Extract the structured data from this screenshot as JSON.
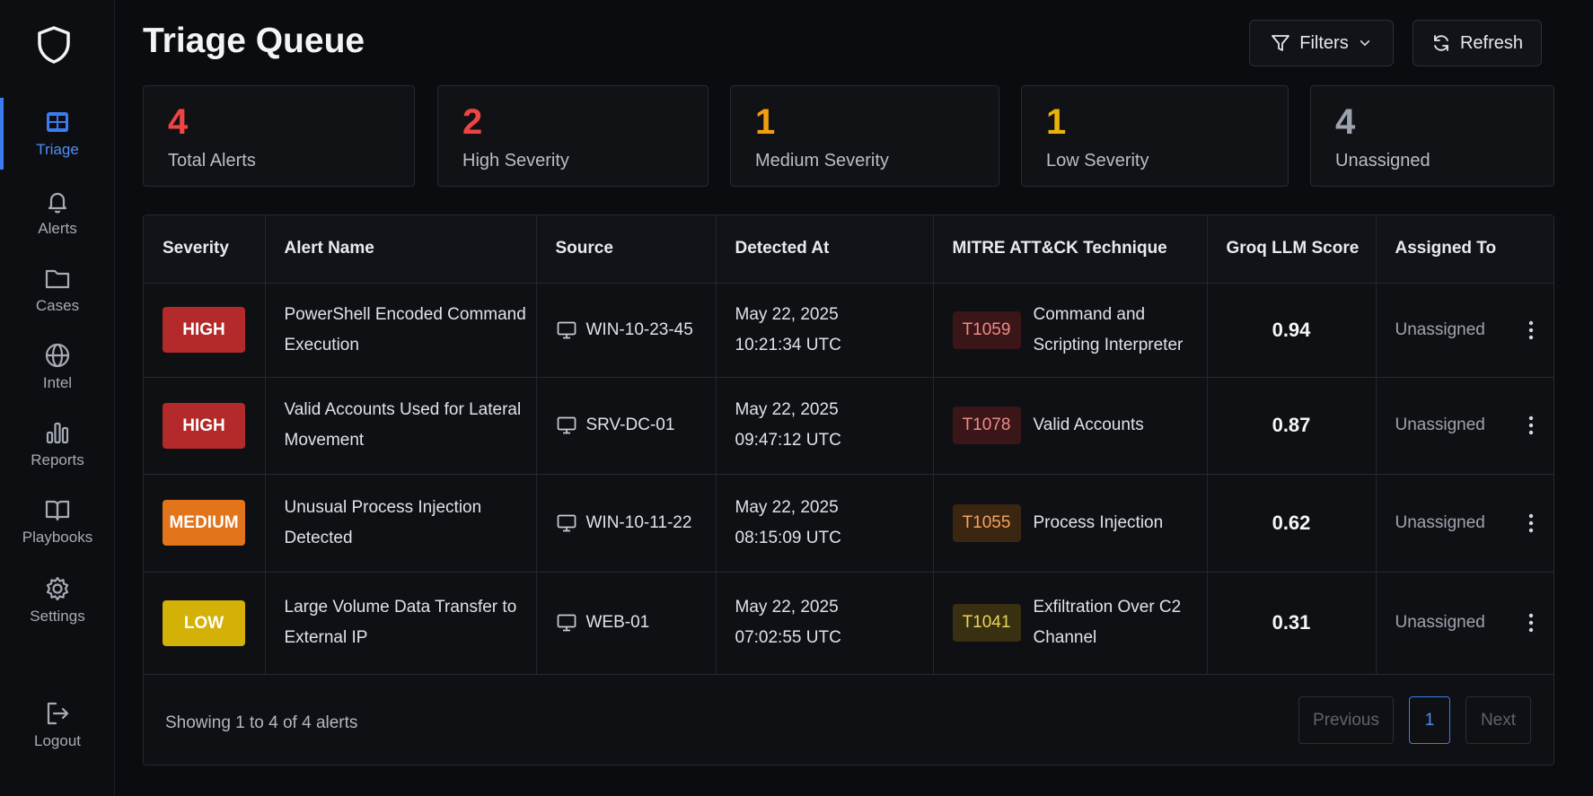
{
  "sidebar": {
    "items": [
      {
        "label": "Triage",
        "icon": "grid-table-icon",
        "active": true
      },
      {
        "label": "Alerts",
        "icon": "bell-icon"
      },
      {
        "label": "Cases",
        "icon": "folder-icon"
      },
      {
        "label": "Intel",
        "icon": "globe-icon"
      },
      {
        "label": "Reports",
        "icon": "bar-chart-icon"
      },
      {
        "label": "Playbooks",
        "icon": "book-icon"
      },
      {
        "label": "Settings",
        "icon": "gear-icon"
      }
    ],
    "logout": "Logout"
  },
  "header": {
    "title": "Triage Queue",
    "filters_label": "Filters",
    "refresh_label": "Refresh"
  },
  "stats": [
    {
      "value": "4",
      "label": "Total Alerts",
      "color": "#ef4444"
    },
    {
      "value": "2",
      "label": "High Severity",
      "color": "#ef4444"
    },
    {
      "value": "1",
      "label": "Medium Severity",
      "color": "#f59e0b"
    },
    {
      "value": "1",
      "label": "Low Severity",
      "color": "#eab308"
    },
    {
      "value": "4",
      "label": "Unassigned",
      "color": "#9ca3af"
    }
  ],
  "table": {
    "headers": [
      "Severity",
      "Alert Name",
      "Source",
      "Detected At",
      "MITRE ATT&CK Technique",
      "Groq LLM Score",
      "Assigned To"
    ],
    "rows": [
      {
        "severity": "HIGH",
        "name": "PowerShell Encoded Command Execution",
        "source": "WIN-10-23-45",
        "detected": "May 22, 2025 10:21:34 UTC",
        "technique_id": "T1059",
        "technique": "Command and Scripting Interpreter",
        "score": "0.94",
        "assigned": "Unassigned"
      },
      {
        "severity": "HIGH",
        "name": "Valid Accounts Used for Lateral Movement",
        "source": "SRV-DC-01",
        "detected": "May 22, 2025 09:47:12 UTC",
        "technique_id": "T1078",
        "technique": "Valid Accounts",
        "score": "0.87",
        "assigned": "Unassigned"
      },
      {
        "severity": "MEDIUM",
        "name": "Unusual Process Injection Detected",
        "source": "WIN-10-11-22",
        "detected": "May 22, 2025 08:15:09 UTC",
        "technique_id": "T1055",
        "technique": "Process Injection",
        "score": "0.62",
        "assigned": "Unassigned"
      },
      {
        "severity": "LOW",
        "name": "Large Volume Data Transfer to External IP",
        "source": "WEB-01",
        "detected": "May 22, 2025 07:02:55 UTC",
        "technique_id": "T1041",
        "technique": "Exfiltration Over C2 Channel",
        "score": "0.31",
        "assigned": "Unassigned"
      }
    ]
  },
  "severity_colors": {
    "HIGH": {
      "badge": "#b42a2a",
      "code_bg": "#3a1618",
      "code_fg": "#f08a8a"
    },
    "MEDIUM": {
      "badge": "#e2741b",
      "code_bg": "#3b2612",
      "code_fg": "#f5a35f"
    },
    "LOW": {
      "badge": "#d4b106",
      "code_bg": "#383010",
      "code_fg": "#eed35a"
    }
  },
  "footer": {
    "showing": "Showing 1 to 4 of 4 alerts",
    "previous": "Previous",
    "page": "1",
    "next": "Next"
  }
}
